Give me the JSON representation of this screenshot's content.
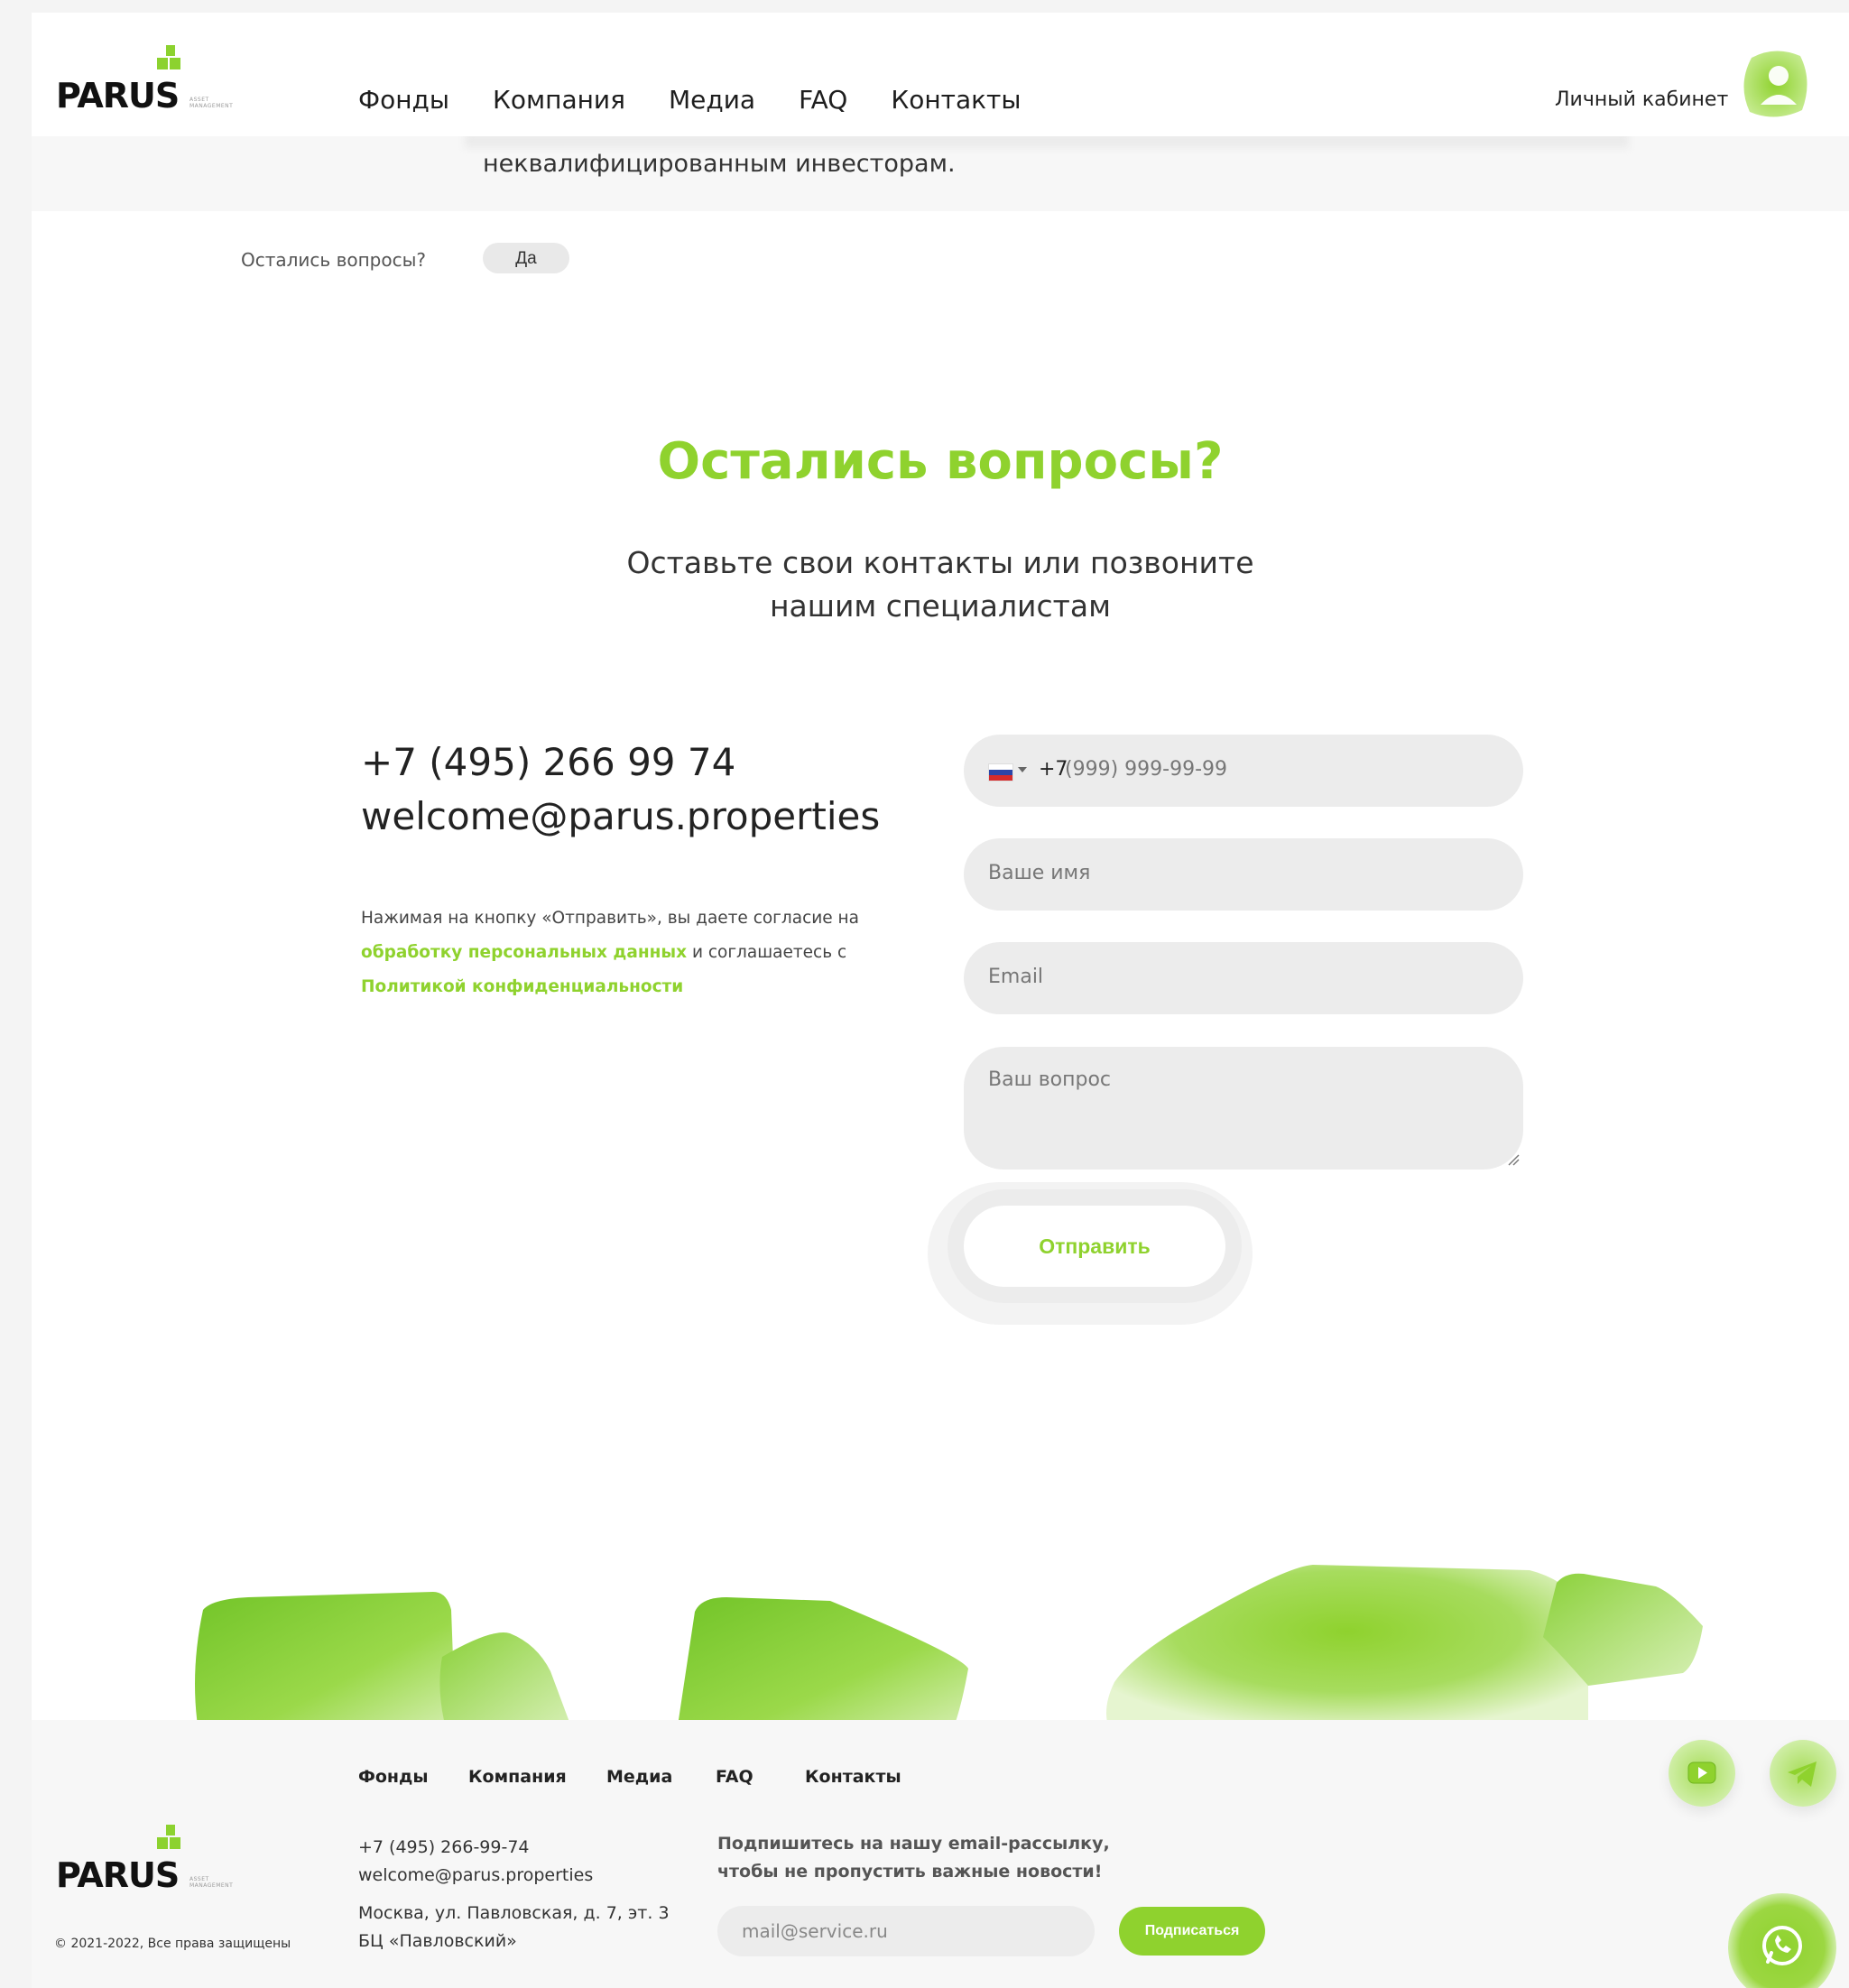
{
  "brand": {
    "name": "PARUS",
    "sub": "ASSET MANAGEMENT",
    "accent": "#8fd22e"
  },
  "header": {
    "nav": [
      "Фонды",
      "Компания",
      "Медиа",
      "FAQ",
      "Контакты"
    ],
    "cabinet": "Личный кабинет",
    "avatar_icon": "user-icon"
  },
  "faq": {
    "tail_text": "неквалифицированным инвесторам.",
    "question_label": "Остались вопросы?",
    "answer_chip": "Да"
  },
  "contact": {
    "title": "Остались вопросы?",
    "subtitle_line1": "Оставьте свои контакты или позвоните",
    "subtitle_line2": "нашим специалистам",
    "phone": "+7 (495) 266 99 74",
    "email": "welcome@parus.properties",
    "consent_pre": "Нажимая на кнопку «Отправить», вы даете согласие на",
    "consent_link1": "обработку персональных данных",
    "consent_mid": " и соглашаетесь с",
    "consent_link2": "Политикой конфиденциальности"
  },
  "form": {
    "phone_code": "+7",
    "phone_placeholder": "(999) 999-99-99",
    "name_placeholder": "Ваше имя",
    "email_placeholder": "Email",
    "question_placeholder": "Ваш вопрос",
    "submit": "Отправить"
  },
  "footer": {
    "nav": [
      "Фонды",
      "Компания",
      "Медиа",
      "FAQ",
      "Контакты"
    ],
    "phone": "+7 (495) 266-99-74",
    "email": "welcome@parus.properties",
    "address_line1": "Москва, ул. Павловская, д. 7, эт. 3",
    "address_line2": "БЦ «Павловский»",
    "subscribe_line1": "Подпишитесь на нашу email-рассылку,",
    "subscribe_line2": "чтобы не пропустить важные новости!",
    "subscribe_placeholder": "mail@service.ru",
    "subscribe_button": "Подписаться",
    "copyright": "© 2021-2022, Все права защищены",
    "social": [
      "youtube-icon",
      "telegram-icon",
      "whatsapp-icon"
    ]
  }
}
